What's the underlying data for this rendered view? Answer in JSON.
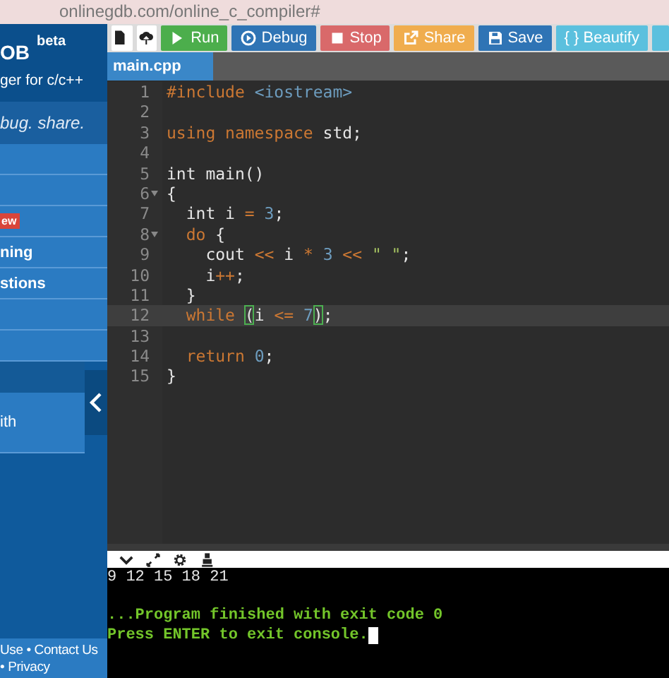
{
  "browser": {
    "address": "onlinegdb.com/online_c_compiler#"
  },
  "sidebar": {
    "logo": "OB",
    "logo_badge": "beta",
    "tagline": "ger for c/c++",
    "slogan": "bug. share.",
    "items": [
      {
        "kind": "blank",
        "selected": false
      },
      {
        "kind": "blank",
        "selected": false
      },
      {
        "kind": "badge",
        "label": "ew",
        "selected": false
      },
      {
        "kind": "link",
        "label": "ning",
        "selected": false
      },
      {
        "kind": "link",
        "label": "stions",
        "selected": false
      },
      {
        "kind": "blank",
        "selected": false
      },
      {
        "kind": "blank",
        "selected": false
      },
      {
        "kind": "blank",
        "selected": true
      },
      {
        "kind": "tall",
        "label": "ith",
        "selected": false
      }
    ],
    "footer": [
      "Use • Contact Us",
      "• Privacy"
    ]
  },
  "toolbar": [
    {
      "kind": "file",
      "color": "#ffffff"
    },
    {
      "kind": "upload",
      "color": "#ffffff"
    },
    {
      "kind": "run",
      "label": "Run",
      "color": "#4cae4c"
    },
    {
      "kind": "debug",
      "label": "Debug",
      "color": "#2f74b5"
    },
    {
      "kind": "stop",
      "label": "Stop",
      "color": "#d9696a"
    },
    {
      "kind": "share",
      "label": "Share",
      "color": "#f0ad4e"
    },
    {
      "kind": "save",
      "label": "Save",
      "color": "#2f74b5"
    },
    {
      "kind": "beautify",
      "label": "{ } Beautify",
      "color": "#5bc0de"
    },
    {
      "kind": "blank",
      "color": "#5bc0de"
    }
  ],
  "tabs": [
    {
      "label": "main.cpp",
      "selected": true
    }
  ],
  "editor": {
    "lines": [
      {
        "number": "1",
        "fold": false,
        "current": false,
        "tokens": [
          {
            "kind": "directive",
            "text": "#include "
          },
          {
            "kind": "header",
            "text": "<iostream>"
          }
        ]
      },
      {
        "number": "2",
        "fold": false,
        "current": false
      },
      {
        "number": "3",
        "fold": false,
        "current": false,
        "tokens": [
          {
            "kind": "keyword",
            "text": "using namespace "
          },
          {
            "kind": "plain",
            "text": "std;"
          }
        ]
      },
      {
        "number": "4",
        "fold": false,
        "current": false
      },
      {
        "number": "5",
        "fold": false,
        "current": false,
        "tokens": [
          {
            "kind": "plain",
            "text": "int main()"
          }
        ]
      },
      {
        "number": "6",
        "fold": true,
        "current": false,
        "tokens": [
          {
            "kind": "plain",
            "text": "{"
          }
        ]
      },
      {
        "number": "7",
        "fold": false,
        "current": false,
        "tokens": [
          {
            "kind": "plain",
            "text": "  int i "
          },
          {
            "kind": "operator",
            "text": "= "
          },
          {
            "kind": "number",
            "text": "3"
          },
          {
            "kind": "plain",
            "text": ";"
          }
        ]
      },
      {
        "number": "8",
        "fold": true,
        "current": false,
        "tokens": [
          {
            "kind": "keyword",
            "text": "  do "
          },
          {
            "kind": "plain",
            "text": "{"
          }
        ]
      },
      {
        "number": "9",
        "fold": false,
        "current": false,
        "tokens": [
          {
            "kind": "plain",
            "text": "    cout "
          },
          {
            "kind": "operator",
            "text": "<< "
          },
          {
            "kind": "plain",
            "text": "i "
          },
          {
            "kind": "operator",
            "text": "* "
          },
          {
            "kind": "number",
            "text": "3 "
          },
          {
            "kind": "operator",
            "text": "<< "
          },
          {
            "kind": "string",
            "text": "\" \""
          },
          {
            "kind": "plain",
            "text": ";"
          }
        ]
      },
      {
        "number": "10",
        "fold": false,
        "current": false,
        "tokens": [
          {
            "kind": "plain",
            "text": "    i"
          },
          {
            "kind": "operator",
            "text": "++"
          },
          {
            "kind": "plain",
            "text": ";"
          }
        ]
      },
      {
        "number": "11",
        "fold": false,
        "current": false,
        "tokens": [
          {
            "kind": "plain",
            "text": "  }"
          }
        ]
      },
      {
        "number": "12",
        "fold": false,
        "current": true,
        "tokens": [
          {
            "kind": "keyword",
            "text": "  while "
          },
          {
            "kind": "bracket",
            "text": "("
          },
          {
            "kind": "plain",
            "text": "i "
          },
          {
            "kind": "operator",
            "text": "<= "
          },
          {
            "kind": "number",
            "text": "7"
          },
          {
            "kind": "bracket",
            "text": ")"
          },
          {
            "kind": "plain",
            "text": ";"
          }
        ]
      },
      {
        "number": "13",
        "fold": false,
        "current": false
      },
      {
        "number": "14",
        "fold": false,
        "current": false,
        "tokens": [
          {
            "kind": "keyword",
            "text": "  return "
          },
          {
            "kind": "number",
            "text": "0"
          },
          {
            "kind": "plain",
            "text": ";"
          }
        ]
      },
      {
        "number": "15",
        "fold": false,
        "current": false,
        "tokens": [
          {
            "kind": "plain",
            "text": "}"
          }
        ]
      }
    ]
  },
  "console": {
    "tools": [
      {
        "kind": "collapse"
      },
      {
        "kind": "expand"
      },
      {
        "kind": "settings"
      },
      {
        "kind": "clear"
      }
    ],
    "lines": [
      {
        "kind": "output",
        "text": "9 12 15 18 21"
      },
      {
        "kind": "blank"
      },
      {
        "kind": "status",
        "text": "...Program finished with exit code 0"
      },
      {
        "kind": "status",
        "text": "Press ENTER to exit console.",
        "cursor": true
      }
    ]
  }
}
